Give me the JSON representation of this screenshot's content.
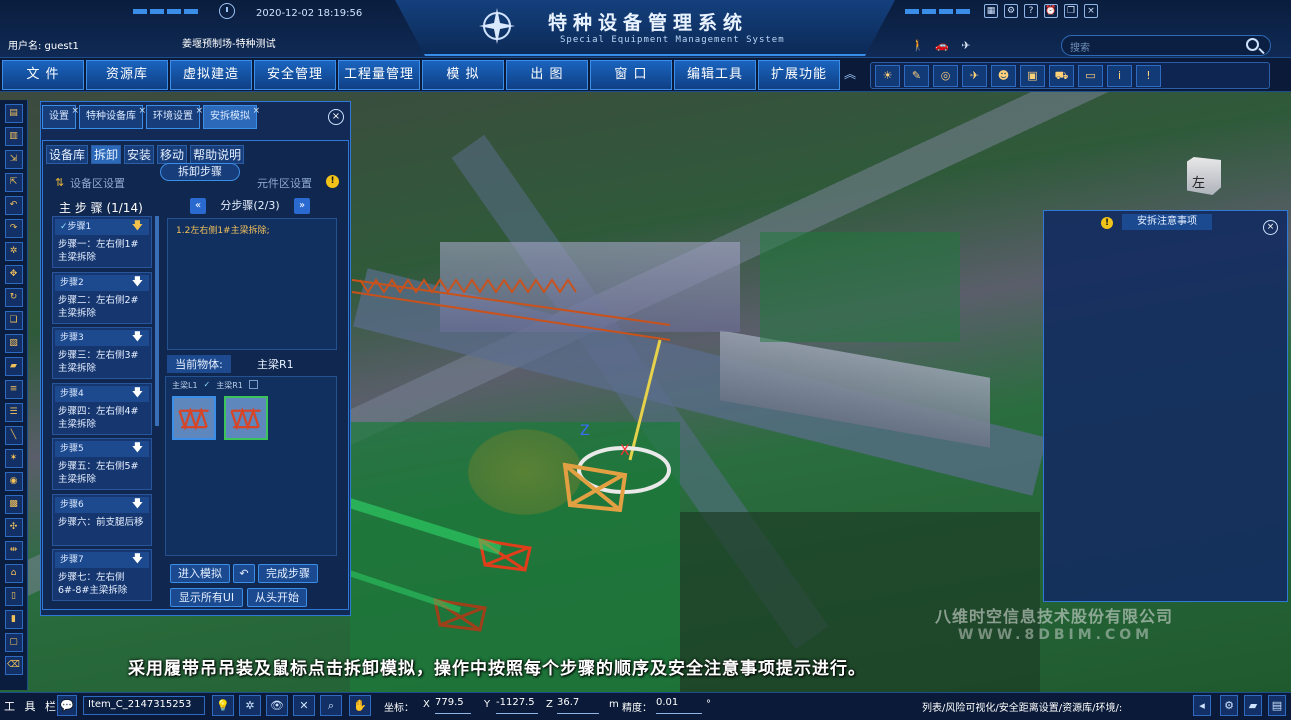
{
  "header": {
    "title_cn": "特种设备管理系统",
    "title_en": "Special Equipment Management System",
    "datetime": "2020-12-02   18:19:56",
    "user": "用户名: guest1",
    "project": "姜堰预制场-特种测试",
    "search_placeholder": "搜索"
  },
  "menu": [
    "文 件",
    "资源库",
    "虚拟建造",
    "安全管理",
    "工程量管理",
    "模 拟",
    "出 图",
    "窗 口",
    "编辑工具",
    "扩展功能"
  ],
  "panel": {
    "tabs": [
      "设置",
      "特种设备库",
      "环境设置",
      "安拆模拟"
    ],
    "subtabs": [
      "设备库",
      "拆卸",
      "安装",
      "移动",
      "帮助说明"
    ],
    "caption": "拆卸步骤",
    "area_setting": "设备区设置",
    "part_setting": "元件区设置",
    "main_steps_title": "主 步 骤 (1/14)",
    "steps": [
      {
        "head": "步骤1",
        "desc": "步骤一：左右侧1#主梁拆除"
      },
      {
        "head": "步骤2",
        "desc": "步骤二：左右侧2#主梁拆除"
      },
      {
        "head": "步骤3",
        "desc": "步骤三：左右侧3#主梁拆除"
      },
      {
        "head": "步骤4",
        "desc": "步骤四：左右侧4#主梁拆除"
      },
      {
        "head": "步骤5",
        "desc": "步骤五：左右侧5#主梁拆除"
      },
      {
        "head": "步骤6",
        "desc": "步骤六：前支腿后移"
      },
      {
        "head": "步骤7",
        "desc": "步骤七：左右侧6#-8#主梁拆除"
      }
    ],
    "substep": "分步骤(2/3)",
    "substep_desc": "1.2左右侧1#主梁拆除;",
    "current_object_label": "当前物体:",
    "current_object": "主梁R1",
    "objects": [
      "主梁L1",
      "主梁R1"
    ],
    "buttons": {
      "enter_sim": "进入模拟",
      "finish_step": "完成步骤",
      "show_all": "显示所有UI",
      "restart": "从头开始"
    }
  },
  "right_panel": {
    "title": "安拆注意事项"
  },
  "viewcube": "左",
  "watermark": {
    "line1": "八维时空信息技术股份有限公司",
    "line2": "WWW.8DBIM.COM"
  },
  "subtitle": "采用履带吊吊装及鼠标点击拆卸模拟，操作中按照每个步骤的顺序及安全注意事项提示进行。",
  "bottom": {
    "toolbar_label": "工 具 栏",
    "item": "Item_C_2147315253",
    "coord_label": "坐标：",
    "x_label": "X",
    "x": "779.5",
    "y_label": "Y",
    "y": "-1127.5",
    "z_label": "Z",
    "z": "36.7",
    "unit": "m",
    "precision_label": "精度：",
    "precision": "0.01",
    "degree": "°",
    "status": "列表/风险可视化/安全距离设置/资源库/环境/:"
  }
}
